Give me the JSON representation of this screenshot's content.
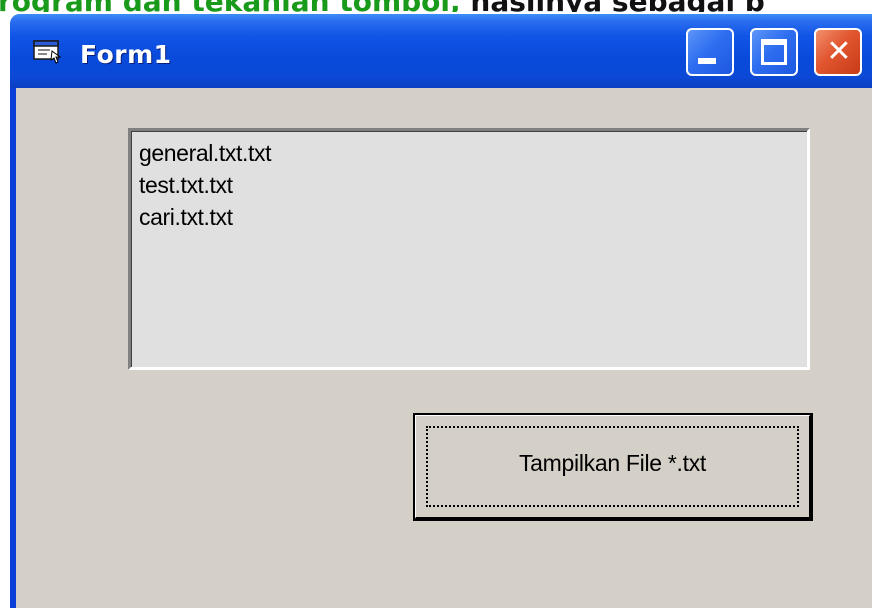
{
  "caption": {
    "green_text": "rogram dan tekanlah tombol,",
    "black_text": " hasilnya sebagai b"
  },
  "window": {
    "title": "Form1",
    "colors": {
      "titlebar": "#0a4adb",
      "client": "#d4d0c8",
      "close_button": "#e1552f"
    }
  },
  "listbox": {
    "items": [
      {
        "label": "general.txt.txt"
      },
      {
        "label": "test.txt.txt"
      },
      {
        "label": "cari.txt.txt"
      }
    ]
  },
  "button": {
    "label": "Tampilkan File *.txt"
  },
  "icons": {
    "app": "form-window-icon",
    "minimize": "minimize-icon",
    "maximize": "maximize-icon",
    "close": "close-icon"
  }
}
